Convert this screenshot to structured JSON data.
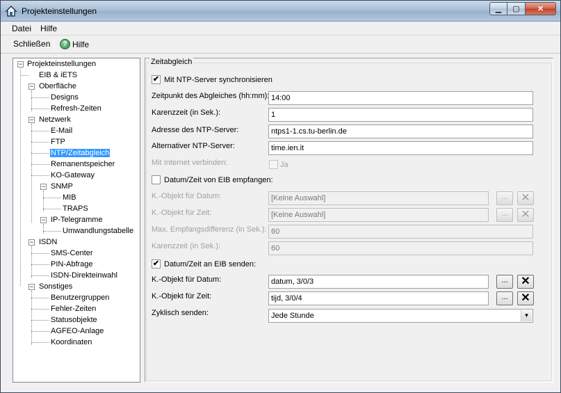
{
  "window": {
    "title": "Projekteinstellungen"
  },
  "menu": {
    "items": [
      "Datei",
      "Hilfe"
    ]
  },
  "toolbar": {
    "close_label": "Schließen",
    "help_label": "Hilfe",
    "help_icon": "?"
  },
  "tree": {
    "nodes": [
      "Projekteinstellungen",
      "EIB & iETS",
      "Oberfläche",
      "Designs",
      "Refresh-Zeiten",
      "Netzwerk",
      "E-Mail",
      "FTP",
      "NTP/Zeitabgleich",
      "Remanentspeicher",
      "KO-Gateway",
      "SNMP",
      "MIB",
      "TRAPS",
      "IP-Telegramme",
      "Umwandlungstabelle",
      "ISDN",
      "SMS-Center",
      "PIN-Abfrage",
      "ISDN-Direkteinwahl",
      "Sonstiges",
      "Benutzergruppen",
      "Fehler-Zeiten",
      "Statusobjekte",
      "AGFEO-Anlage",
      "Koordinaten"
    ]
  },
  "form": {
    "group_title": "Zeitabgleich",
    "ntp_sync": {
      "label": "Mit NTP-Server synchronisieren",
      "checked": true
    },
    "sync_time": {
      "label": "Zeitpunkt des Abgleiches (hh:mm):",
      "value": "14:00"
    },
    "grace_time": {
      "label": "Karenzzeit (in Sek.):",
      "value": "1"
    },
    "ntp_address": {
      "label": "Adresse des NTP-Server:",
      "value": "ntps1-1.cs.tu-berlin.de"
    },
    "ntp_alt": {
      "label": "Alternativer NTP-Server:",
      "value": "time.ien.it"
    },
    "internet": {
      "label": "Mit Internet verbinden:",
      "check_label": "Ja"
    },
    "receive": {
      "label": "Datum/Zeit von EIB empfangen:",
      "checked": false
    },
    "recv_date_obj": {
      "label": "K.-Objekt für Datum:",
      "value": "[Keine Auswahl]"
    },
    "recv_time_obj": {
      "label": "K.-Objekt für Zeit:",
      "value": "[Keine Auswahl]"
    },
    "max_diff": {
      "label": "Max. Empfangsdifferenz (in Sek.):",
      "value": "60"
    },
    "recv_grace": {
      "label": "Karenzzeit (in Sek.):",
      "value": "60"
    },
    "send": {
      "label": "Datum/Zeit an EIB senden:",
      "checked": true
    },
    "send_date_obj": {
      "label": "K.-Objekt für Datum:",
      "value": "datum, 3/0/3"
    },
    "send_time_obj": {
      "label": "K.-Objekt für Zeit:",
      "value": "tijd, 3/0/4"
    },
    "cyclic": {
      "label": "Zyklisch senden:",
      "value": "Jede Stunde"
    },
    "dots_label": "...",
    "clear_label": "✕",
    "check_mark": "✔"
  }
}
